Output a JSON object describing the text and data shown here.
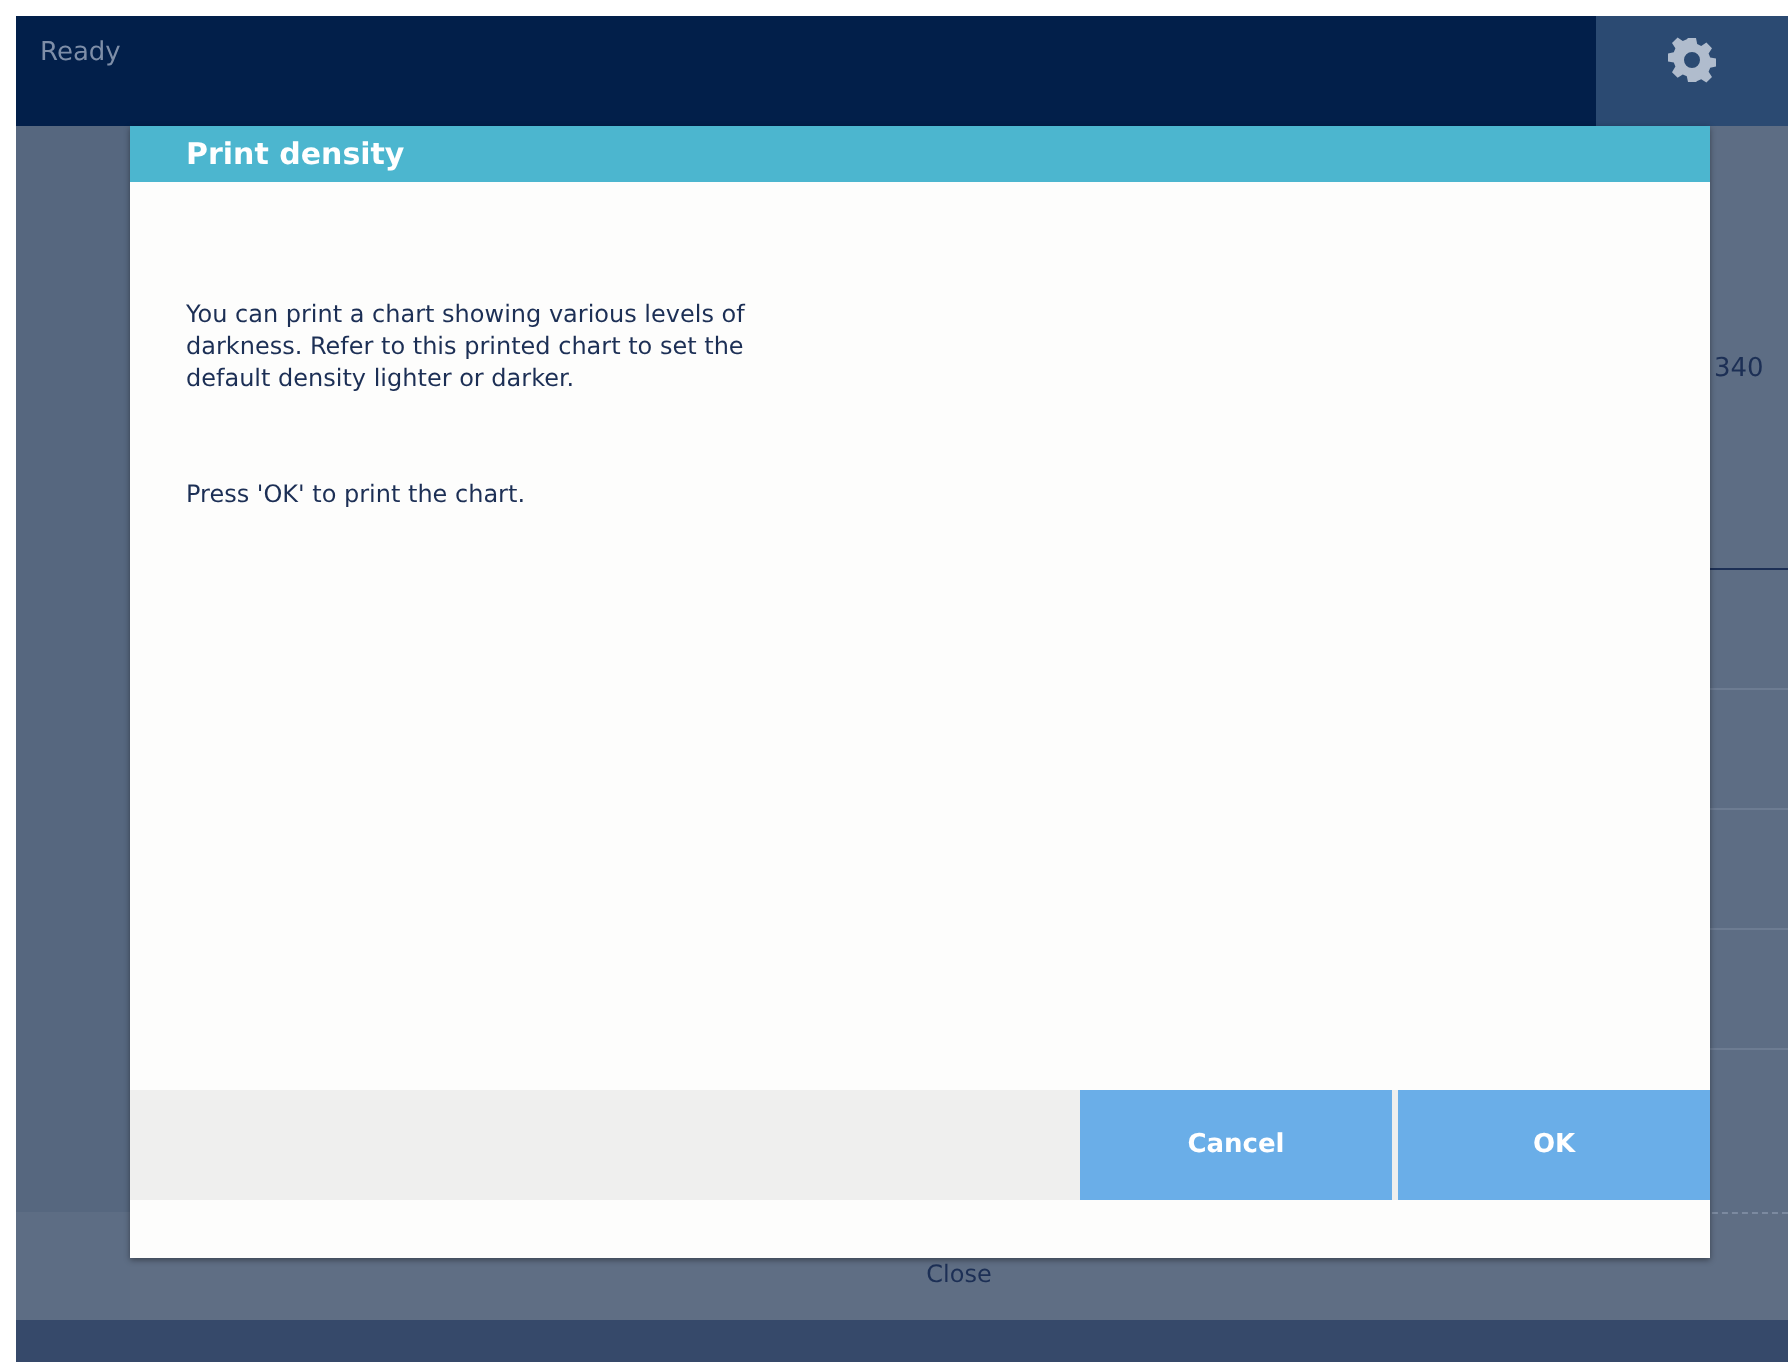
{
  "status_bar": {
    "status": "Ready"
  },
  "background": {
    "value": "340",
    "close_button": "Close"
  },
  "dialog": {
    "title": "Print density",
    "paragraphs": [
      "You can print a chart showing various levels of darkness. Refer to this printed chart to set the default density lighter or darker.",
      "Press 'OK' to print the chart."
    ],
    "buttons": [
      "Cancel",
      "OK"
    ]
  }
}
